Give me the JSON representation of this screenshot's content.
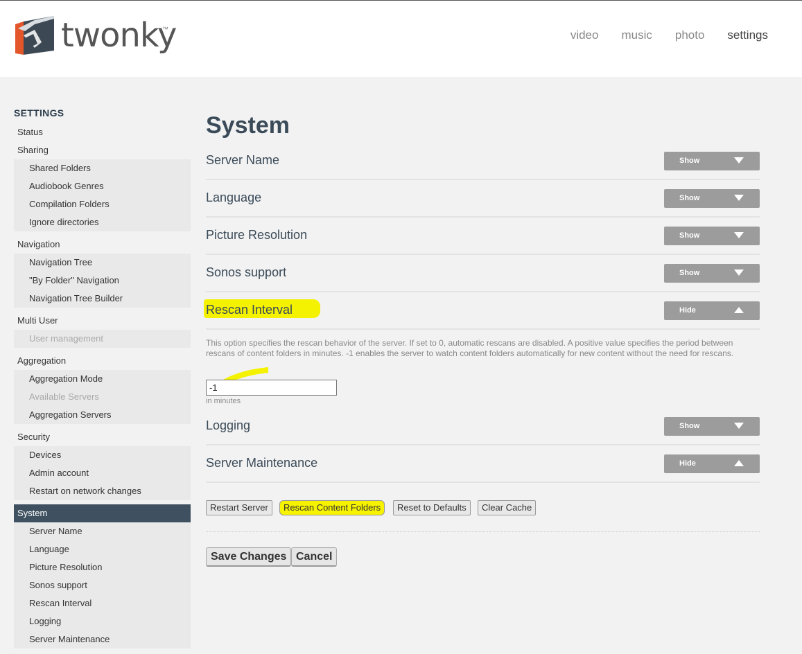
{
  "header": {
    "logo_text": "twonky",
    "logo_tm": "™",
    "nav": [
      {
        "label": "video"
      },
      {
        "label": "music"
      },
      {
        "label": "photo"
      },
      {
        "label": "settings",
        "active": true
      }
    ]
  },
  "sidebar": {
    "title": "SETTINGS",
    "status": "Status",
    "sharing": {
      "label": "Sharing",
      "items": [
        "Shared Folders",
        "Audiobook Genres",
        "Compilation Folders",
        "Ignore directories"
      ]
    },
    "navigation": {
      "label": "Navigation",
      "items": [
        "Navigation Tree",
        "\"By Folder\" Navigation",
        "Navigation Tree Builder"
      ]
    },
    "multi_user": {
      "label": "Multi User",
      "items": [
        "User management"
      ]
    },
    "aggregation": {
      "label": "Aggregation",
      "items": [
        "Aggregation Mode",
        "Available Servers",
        "Aggregation Servers"
      ]
    },
    "security": {
      "label": "Security",
      "items": [
        "Devices",
        "Admin account",
        "Restart on network changes"
      ]
    },
    "system": {
      "label": "System",
      "items": [
        "Server Name",
        "Language",
        "Picture Resolution",
        "Sonos support",
        "Rescan Interval",
        "Logging",
        "Server Maintenance"
      ]
    }
  },
  "main": {
    "title": "System",
    "show_label": "Show",
    "hide_label": "Hide",
    "sections": [
      "Server Name",
      "Language",
      "Picture Resolution",
      "Sonos support",
      "Rescan Interval",
      "Logging",
      "Server Maintenance"
    ],
    "rescan": {
      "description": "This option specifies the rescan behavior of the server. If set to 0, automatic rescans are disabled. A positive value specifies the period between rescans of content folders in minutes. -1 enables the server to watch content folders automatically for new content without the need for rescans.",
      "value": "-1",
      "units": "in minutes"
    },
    "maintenance_buttons": [
      "Restart Server",
      "Rescan Content Folders",
      "Reset to Defaults",
      "Clear Cache"
    ],
    "save_label": "Save Changes",
    "cancel_label": "Cancel"
  },
  "colors": {
    "accent_dark": "#3f5161",
    "highlight": "#f4f200",
    "toggle_bg": "#9c9c9c",
    "logo_orange": "#e3562a"
  }
}
